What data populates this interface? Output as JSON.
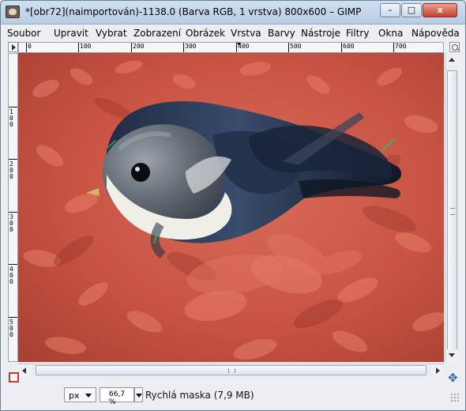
{
  "window": {
    "title": "*[obr72](naimportován)-1138.0 (Barva RGB, 1 vrstva) 800x600 – GIMP",
    "minimize_icon": "minimize-icon",
    "maximize_icon": "maximize-icon",
    "close_icon": "close-icon"
  },
  "menubar": {
    "items": [
      {
        "label": "Soubor"
      },
      {
        "label": "Upravit"
      },
      {
        "label": "Vybrat"
      },
      {
        "label": "Zobrazení"
      },
      {
        "label": "Obrázek"
      },
      {
        "label": "Vrstva"
      },
      {
        "label": "Barvy"
      },
      {
        "label": "Nástroje"
      },
      {
        "label": "Filtry"
      },
      {
        "label": "Okna"
      },
      {
        "label": "Nápověda"
      }
    ]
  },
  "rulers": {
    "horizontal_labels": [
      "0",
      "100",
      "200",
      "300",
      "400",
      "500",
      "600",
      "700"
    ],
    "vertical_labels": [
      "1\n0\n0",
      "2\n0\n0",
      "3\n0\n0",
      "4\n0\n0",
      "5\n0\n0"
    ]
  },
  "canvas": {
    "description_icon": "image-canvas",
    "overlay_color": "#d75b4a",
    "bird_colors": {
      "head": "#5f6670",
      "wing": "#2f3b53",
      "breast": "#f0f0ec",
      "beak": "#d6b26f"
    }
  },
  "statusbar": {
    "unit": "px",
    "zoom": "66,7 %",
    "message": "Rychlá maska (7,9 MB)"
  }
}
